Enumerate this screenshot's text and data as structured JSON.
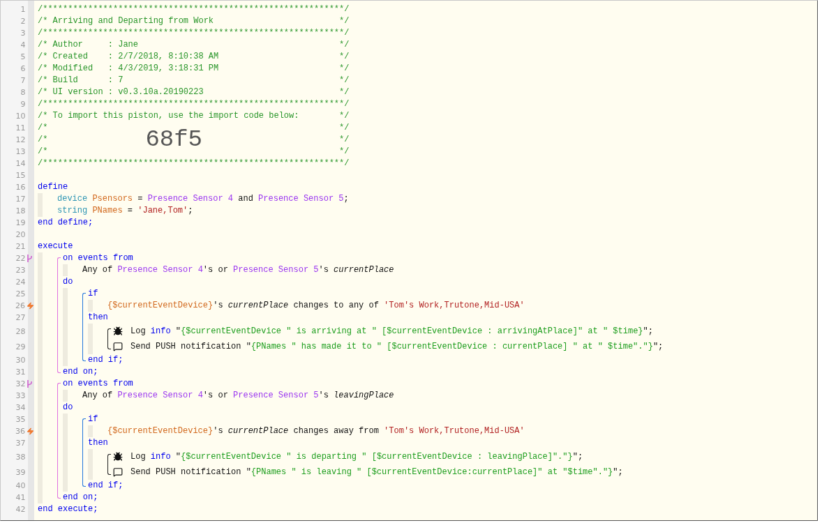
{
  "lines": [
    {
      "kind": "line",
      "number": "1",
      "tokens": [
        {
          "kind": "comment",
          "text": "/************************************************************/"
        }
      ]
    },
    {
      "kind": "line",
      "number": "2",
      "tokens": [
        {
          "kind": "comment",
          "text": "/* Arriving and Departing from Work"
        },
        {
          "kind": "comment_end",
          "text": "*/"
        }
      ]
    },
    {
      "kind": "line",
      "number": "3",
      "tokens": [
        {
          "kind": "comment",
          "text": "/************************************************************/"
        }
      ]
    },
    {
      "kind": "line",
      "number": "4",
      "tokens": [
        {
          "kind": "comment",
          "text": "/* Author     : Jane"
        },
        {
          "kind": "comment_end",
          "text": "*/"
        }
      ]
    },
    {
      "kind": "line",
      "number": "5",
      "tokens": [
        {
          "kind": "comment",
          "text": "/* Created    : 2/7/2018, 8:10:38 AM"
        },
        {
          "kind": "comment_end",
          "text": "*/"
        }
      ]
    },
    {
      "kind": "line",
      "number": "6",
      "tokens": [
        {
          "kind": "comment",
          "text": "/* Modified   : 4/3/2019, 3:18:31 PM"
        },
        {
          "kind": "comment_end",
          "text": "*/"
        }
      ]
    },
    {
      "kind": "line",
      "number": "7",
      "tokens": [
        {
          "kind": "comment",
          "text": "/* Build      : 7"
        },
        {
          "kind": "comment_end",
          "text": "*/"
        }
      ]
    },
    {
      "kind": "line",
      "number": "8",
      "tokens": [
        {
          "kind": "comment",
          "text": "/* UI version : v0.3.10a.20190223"
        },
        {
          "kind": "comment_end",
          "text": "*/"
        }
      ]
    },
    {
      "kind": "line",
      "number": "9",
      "tokens": [
        {
          "kind": "comment",
          "text": "/************************************************************/"
        }
      ]
    },
    {
      "kind": "line",
      "number": "10",
      "tokens": [
        {
          "kind": "comment",
          "text": "/* To import this piston, use the import code below:"
        },
        {
          "kind": "comment_end",
          "text": "*/"
        }
      ]
    },
    {
      "kind": "line",
      "number": "11",
      "tokens": [
        {
          "kind": "comment",
          "text": "/*"
        },
        {
          "kind": "comment_end",
          "text": "*/"
        }
      ]
    },
    {
      "kind": "line",
      "number": "12",
      "tokens": [
        {
          "kind": "comment",
          "text": "/*"
        },
        {
          "kind": "import_code",
          "text": "68f5"
        },
        {
          "kind": "comment_end",
          "text": "*/"
        }
      ]
    },
    {
      "kind": "line",
      "number": "13",
      "tokens": [
        {
          "kind": "comment",
          "text": "/*"
        },
        {
          "kind": "comment_end",
          "text": "*/"
        }
      ]
    },
    {
      "kind": "line",
      "number": "14",
      "tokens": [
        {
          "kind": "comment",
          "text": "/************************************************************/"
        }
      ]
    },
    {
      "kind": "line",
      "number": "15"
    },
    {
      "kind": "line",
      "number": "16",
      "tokens": [
        {
          "kind": "keyword",
          "text": "define"
        }
      ],
      "children": [
        {
          "kind": "line",
          "number": "17",
          "tokens": [
            {
              "kind": "type",
              "text": "device"
            },
            {
              "kind": "variable",
              "text": " Psensors"
            },
            {
              "kind": "plain",
              "text": " = "
            },
            {
              "kind": "device",
              "text": "Presence Sensor 4"
            },
            {
              "kind": "plain",
              "text": " and "
            },
            {
              "kind": "device",
              "text": "Presence Sensor 5"
            },
            {
              "kind": "plain",
              "text": ";"
            }
          ]
        },
        {
          "kind": "line",
          "number": "18",
          "tokens": [
            {
              "kind": "type",
              "text": "string"
            },
            {
              "kind": "variable",
              "text": " PNames"
            },
            {
              "kind": "plain",
              "text": " = "
            },
            {
              "kind": "string",
              "text": "'Jane,Tom'"
            },
            {
              "kind": "plain",
              "text": ";"
            }
          ]
        }
      ]
    },
    {
      "kind": "line",
      "number": "19",
      "tokens": [
        {
          "kind": "keyword",
          "text": "end define;"
        }
      ]
    },
    {
      "kind": "line",
      "number": "20"
    },
    {
      "kind": "line",
      "number": "21",
      "tokens": [
        {
          "kind": "keyword",
          "text": "execute"
        }
      ],
      "children": [
        {
          "kind": "event_block",
          "children": [
            {
              "kind": "trigger_line",
              "number": "22",
              "tokens": [
                {
                  "kind": "keyword",
                  "text": "on events from"
                }
              ],
              "children": [
                {
                  "kind": "line",
                  "number": "23",
                  "tokens": [
                    {
                      "kind": "plain",
                      "text": "Any of "
                    },
                    {
                      "kind": "device",
                      "text": "Presence Sensor 4"
                    },
                    {
                      "kind": "plain",
                      "text": "'s or "
                    },
                    {
                      "kind": "device",
                      "text": "Presence Sensor 5"
                    },
                    {
                      "kind": "plain",
                      "text": "'s "
                    },
                    {
                      "kind": "italic",
                      "text": "currentPlace"
                    }
                  ]
                }
              ]
            },
            {
              "kind": "line",
              "number": "24",
              "tokens": [
                {
                  "kind": "keyword",
                  "text": "do"
                }
              ],
              "children": [
                {
                  "kind": "if_block",
                  "children": [
                    {
                      "kind": "line",
                      "number": "25",
                      "tokens": [
                        {
                          "kind": "keyword",
                          "text": "if"
                        }
                      ],
                      "children": [
                        {
                          "kind": "condition_line",
                          "number": "26",
                          "tokens": [
                            {
                              "kind": "variable",
                              "text": "{$currentEventDevice}"
                            },
                            {
                              "kind": "plain",
                              "text": "'s "
                            },
                            {
                              "kind": "italic",
                              "text": "currentPlace"
                            },
                            {
                              "kind": "plain",
                              "text": " changes to any of "
                            },
                            {
                              "kind": "string",
                              "text": "'Tom's Work,Trutone,Mid-USA'"
                            }
                          ]
                        }
                      ]
                    },
                    {
                      "kind": "line",
                      "number": "27",
                      "tokens": [
                        {
                          "kind": "keyword",
                          "text": "then"
                        }
                      ],
                      "children": [
                        {
                          "kind": "action_block",
                          "children": [
                            {
                              "kind": "log_line",
                              "number": "28",
                              "tokens": [
                                {
                                  "kind": "plain",
                                  "text": "Log "
                                },
                                {
                                  "kind": "keyword",
                                  "text": "info"
                                },
                                {
                                  "kind": "plain",
                                  "text": " \""
                                },
                                {
                                  "kind": "log",
                                  "text": "{$currentEventDevice \" is arriving at \" [$currentEventDevice : arrivingAtPlace]\" at \" $time}"
                                },
                                {
                                  "kind": "plain",
                                  "text": "\";"
                                }
                              ]
                            },
                            {
                              "kind": "notify_line",
                              "number": "29",
                              "tokens": [
                                {
                                  "kind": "plain",
                                  "text": "Send PUSH notification \""
                                },
                                {
                                  "kind": "log",
                                  "text": "{PNames \" has made it to \" [$currentEventDevice : currentPlace] \" at \" $time\".\"}"
                                },
                                {
                                  "kind": "plain",
                                  "text": "\";"
                                }
                              ]
                            }
                          ]
                        }
                      ]
                    },
                    {
                      "kind": "line",
                      "number": "30",
                      "tokens": [
                        {
                          "kind": "keyword",
                          "text": "end if;"
                        }
                      ]
                    }
                  ]
                }
              ]
            },
            {
              "kind": "line",
              "number": "31",
              "tokens": [
                {
                  "kind": "keyword",
                  "text": "end on;"
                }
              ]
            }
          ]
        },
        {
          "kind": "event_block",
          "children": [
            {
              "kind": "trigger_line",
              "number": "32",
              "tokens": [
                {
                  "kind": "keyword",
                  "text": "on events from"
                }
              ],
              "children": [
                {
                  "kind": "line",
                  "number": "33",
                  "tokens": [
                    {
                      "kind": "plain",
                      "text": "Any of "
                    },
                    {
                      "kind": "device",
                      "text": "Presence Sensor 4"
                    },
                    {
                      "kind": "plain",
                      "text": "'s or "
                    },
                    {
                      "kind": "device",
                      "text": "Presence Sensor 5"
                    },
                    {
                      "kind": "plain",
                      "text": "'s "
                    },
                    {
                      "kind": "italic",
                      "text": "leavingPlace"
                    }
                  ]
                }
              ]
            },
            {
              "kind": "line",
              "number": "34",
              "tokens": [
                {
                  "kind": "keyword",
                  "text": "do"
                }
              ],
              "children": [
                {
                  "kind": "if_block",
                  "children": [
                    {
                      "kind": "line",
                      "number": "35",
                      "tokens": [
                        {
                          "kind": "keyword",
                          "text": "if"
                        }
                      ],
                      "children": [
                        {
                          "kind": "condition_line",
                          "number": "36",
                          "tokens": [
                            {
                              "kind": "variable",
                              "text": "{$currentEventDevice}"
                            },
                            {
                              "kind": "plain",
                              "text": "'s "
                            },
                            {
                              "kind": "italic",
                              "text": "currentPlace"
                            },
                            {
                              "kind": "plain",
                              "text": " changes away from "
                            },
                            {
                              "kind": "string",
                              "text": "'Tom's Work,Trutone,Mid-USA'"
                            }
                          ]
                        }
                      ]
                    },
                    {
                      "kind": "line",
                      "number": "37",
                      "tokens": [
                        {
                          "kind": "keyword",
                          "text": "then"
                        }
                      ],
                      "children": [
                        {
                          "kind": "action_block",
                          "children": [
                            {
                              "kind": "log_line",
                              "number": "38",
                              "tokens": [
                                {
                                  "kind": "plain",
                                  "text": "Log "
                                },
                                {
                                  "kind": "keyword",
                                  "text": "info"
                                },
                                {
                                  "kind": "plain",
                                  "text": " \""
                                },
                                {
                                  "kind": "log",
                                  "text": "{$currentEventDevice \" is departing \" [$currentEventDevice : leavingPlace]\".\"}"
                                },
                                {
                                  "kind": "plain",
                                  "text": "\";"
                                }
                              ]
                            },
                            {
                              "kind": "notify_line",
                              "number": "39",
                              "tokens": [
                                {
                                  "kind": "plain",
                                  "text": "Send PUSH notification \""
                                },
                                {
                                  "kind": "log",
                                  "text": "{PNames \" is leaving \" [$currentEventDevice:currentPlace]\" at \"$time\".\"}"
                                },
                                {
                                  "kind": "plain",
                                  "text": "\";"
                                }
                              ]
                            }
                          ]
                        }
                      ]
                    },
                    {
                      "kind": "line",
                      "number": "40",
                      "tokens": [
                        {
                          "kind": "keyword",
                          "text": "end if;"
                        }
                      ]
                    }
                  ]
                }
              ]
            },
            {
              "kind": "line",
              "number": "41",
              "tokens": [
                {
                  "kind": "keyword",
                  "text": "end on;"
                }
              ]
            }
          ]
        }
      ]
    },
    {
      "kind": "line",
      "number": "42",
      "tokens": [
        {
          "kind": "keyword",
          "text": "end execute;"
        }
      ]
    }
  ]
}
